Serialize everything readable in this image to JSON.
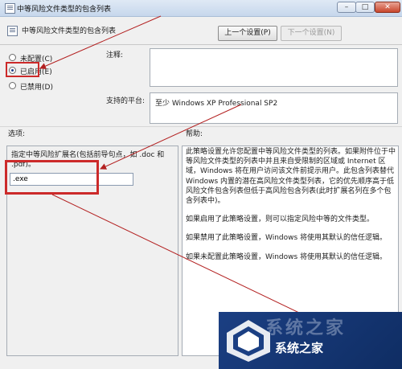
{
  "window": {
    "title": "中等风险文件类型的包含列表",
    "minimize_glyph": "–",
    "maximize_glyph": "□",
    "close_glyph": "✕"
  },
  "header": {
    "title": "中等风险文件类型的包含列表",
    "prev_button": "上一个设置(P)",
    "next_button": "下一个设置(N)",
    "next_disabled": true
  },
  "state": {
    "options": [
      {
        "label": "未配置(C)",
        "checked": false
      },
      {
        "label": "已启用(E)",
        "checked": true
      },
      {
        "label": "已禁用(D)",
        "checked": false
      }
    ],
    "comment_label": "注释:",
    "comment_value": "",
    "platform_label": "支持的平台:",
    "platform_value": "至少 Windows XP Professional SP2"
  },
  "options_section": {
    "label": "选项:",
    "description": "指定中等风险扩展名(包括前导句点，如 .doc 和 .pdf)。",
    "input_value": ".exe"
  },
  "help_section": {
    "label": "帮助:",
    "paragraphs": [
      "此策略设置允许您配置中等风险文件类型的列表。如果附件位于中等风险文件类型的列表中并且来自受限制的区域或 Internet 区域，Windows 将在用户访问该文件前提示用户。此包含列表替代 Windows 内置的潜在高风险文件类型列表，它的优先顺序高于低风险文件包含列表但低于高风险包含列表(此时扩展名列在多个包含列表中)。",
      "如果启用了此策略设置，则可以指定风险中等的文件类型。",
      "如果禁用了此策略设置，Windows 将使用其默认的信任逻辑。",
      "如果未配置此策略设置，Windows 将使用其默认的信任逻辑。"
    ]
  },
  "watermark": {
    "text": "系统之家",
    "faded_text": "系统之家"
  },
  "colors": {
    "annotation": "#cc2a2a",
    "watermark_bg": "#1b3f83"
  }
}
